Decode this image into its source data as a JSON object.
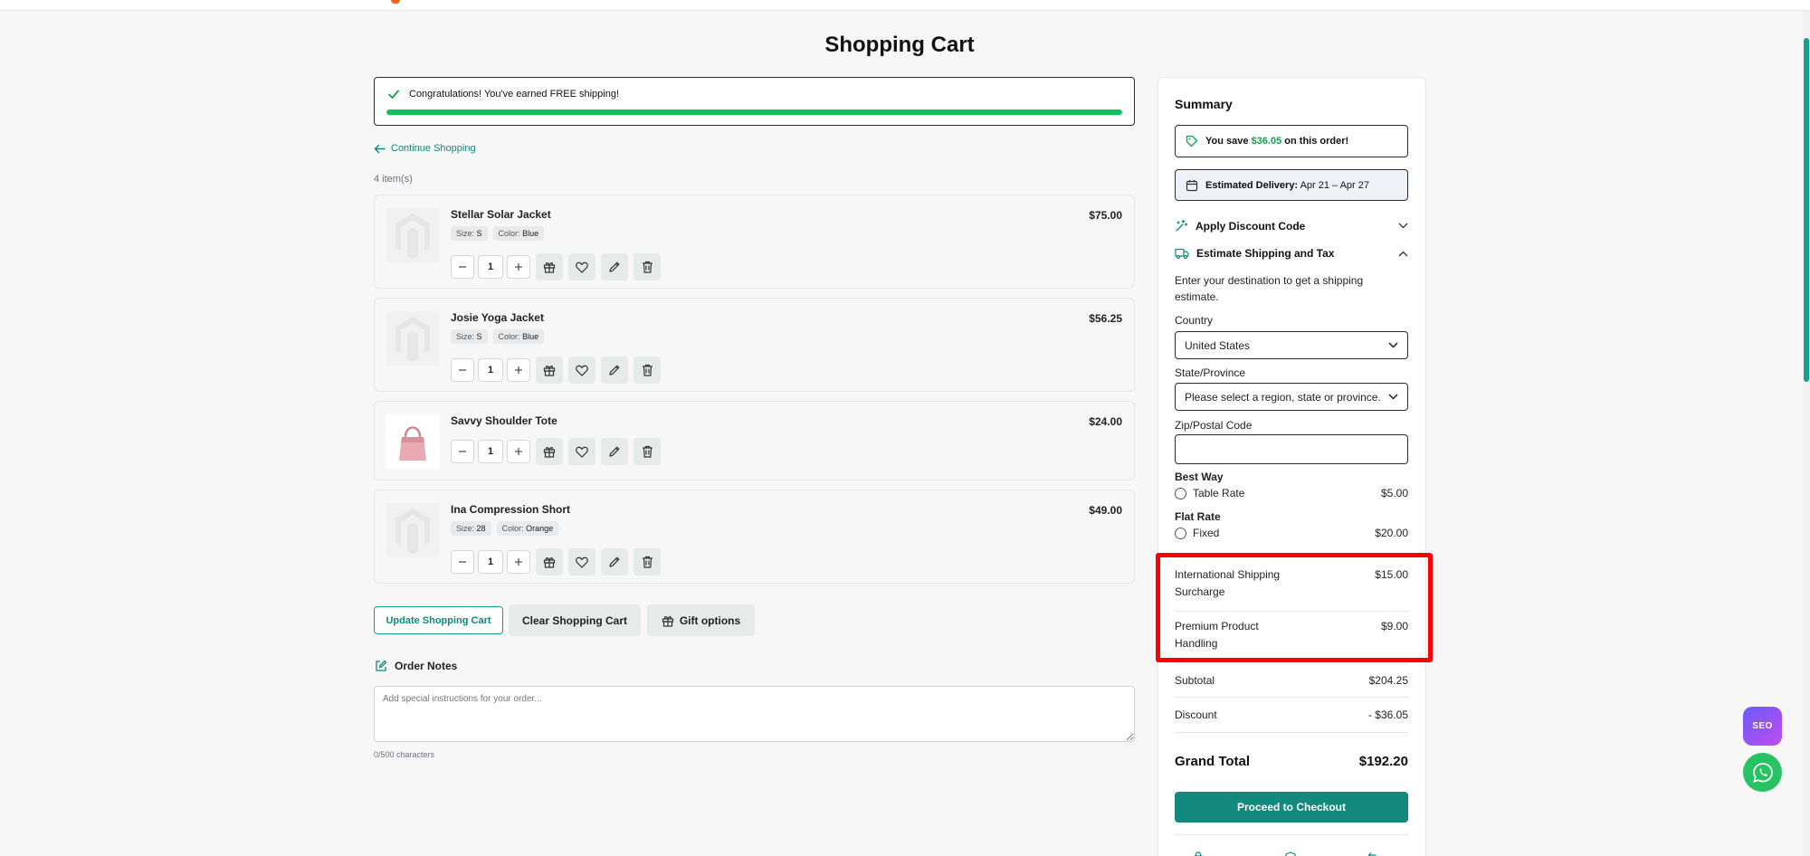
{
  "page": {
    "title": "Shopping Cart"
  },
  "free_shipping": {
    "message": "Congratulations! You've earned FREE shipping!",
    "progress_percent": 100
  },
  "cart": {
    "continue_label": "Continue Shopping",
    "item_count": "4 item(s)",
    "items": [
      {
        "name": "Stellar Solar Jacket",
        "price": "$75.00",
        "size_label": "Size:",
        "size": "S",
        "color_label": "Color:",
        "color": "Blue",
        "qty": "1"
      },
      {
        "name": "Josie Yoga Jacket",
        "price": "$56.25",
        "size_label": "Size:",
        "size": "S",
        "color_label": "Color:",
        "color": "Blue",
        "qty": "1"
      },
      {
        "name": "Savvy Shoulder Tote",
        "price": "$24.00",
        "qty": "1"
      },
      {
        "name": "Ina Compression Short",
        "price": "$49.00",
        "size_label": "Size:",
        "size": "28",
        "color_label": "Color:",
        "color": "Orange",
        "qty": "1"
      }
    ],
    "update_label": "Update Shopping Cart",
    "clear_label": "Clear Shopping Cart",
    "gift_label": "Gift options"
  },
  "notes": {
    "title": "Order Notes",
    "placeholder": "Add special instructions for your order...",
    "counter": "0/500 characters"
  },
  "summary": {
    "title": "Summary",
    "save_prefix": "You save",
    "save_amount": "$36.05",
    "save_suffix": "on this order!",
    "delivery_label": "Estimated Delivery:",
    "delivery_range": "Apr 21 – Apr 27",
    "discount_label": "Apply Discount Code",
    "shipping_label": "Estimate Shipping and Tax",
    "shipping_hint": "Enter your destination to get a shipping estimate.",
    "country_label": "Country",
    "country_value": "United States",
    "state_label": "State/Province",
    "state_value": "Please select a region, state or province.",
    "zip_label": "Zip/Postal Code",
    "methods": [
      {
        "carrier": "Best Way",
        "option": "Table Rate",
        "price": "$5.00"
      },
      {
        "carrier": "Flat Rate",
        "option": "Fixed",
        "price": "$20.00"
      }
    ],
    "fees": [
      {
        "label": "International Shipping Surcharge",
        "amount": "$15.00"
      },
      {
        "label": "Premium Product Handling",
        "amount": "$9.00"
      }
    ],
    "subtotal_label": "Subtotal",
    "subtotal": "$204.25",
    "discount_row_label": "Discount",
    "discount": "- $36.05",
    "grand_total_label": "Grand Total",
    "grand_total": "$192.20",
    "checkout_label": "Proceed to Checkout"
  },
  "widgets": {
    "seo_label": "SEO"
  },
  "colors": {
    "accent": "#138a7d",
    "success": "#10c25b",
    "highlight": "#ff0000"
  }
}
